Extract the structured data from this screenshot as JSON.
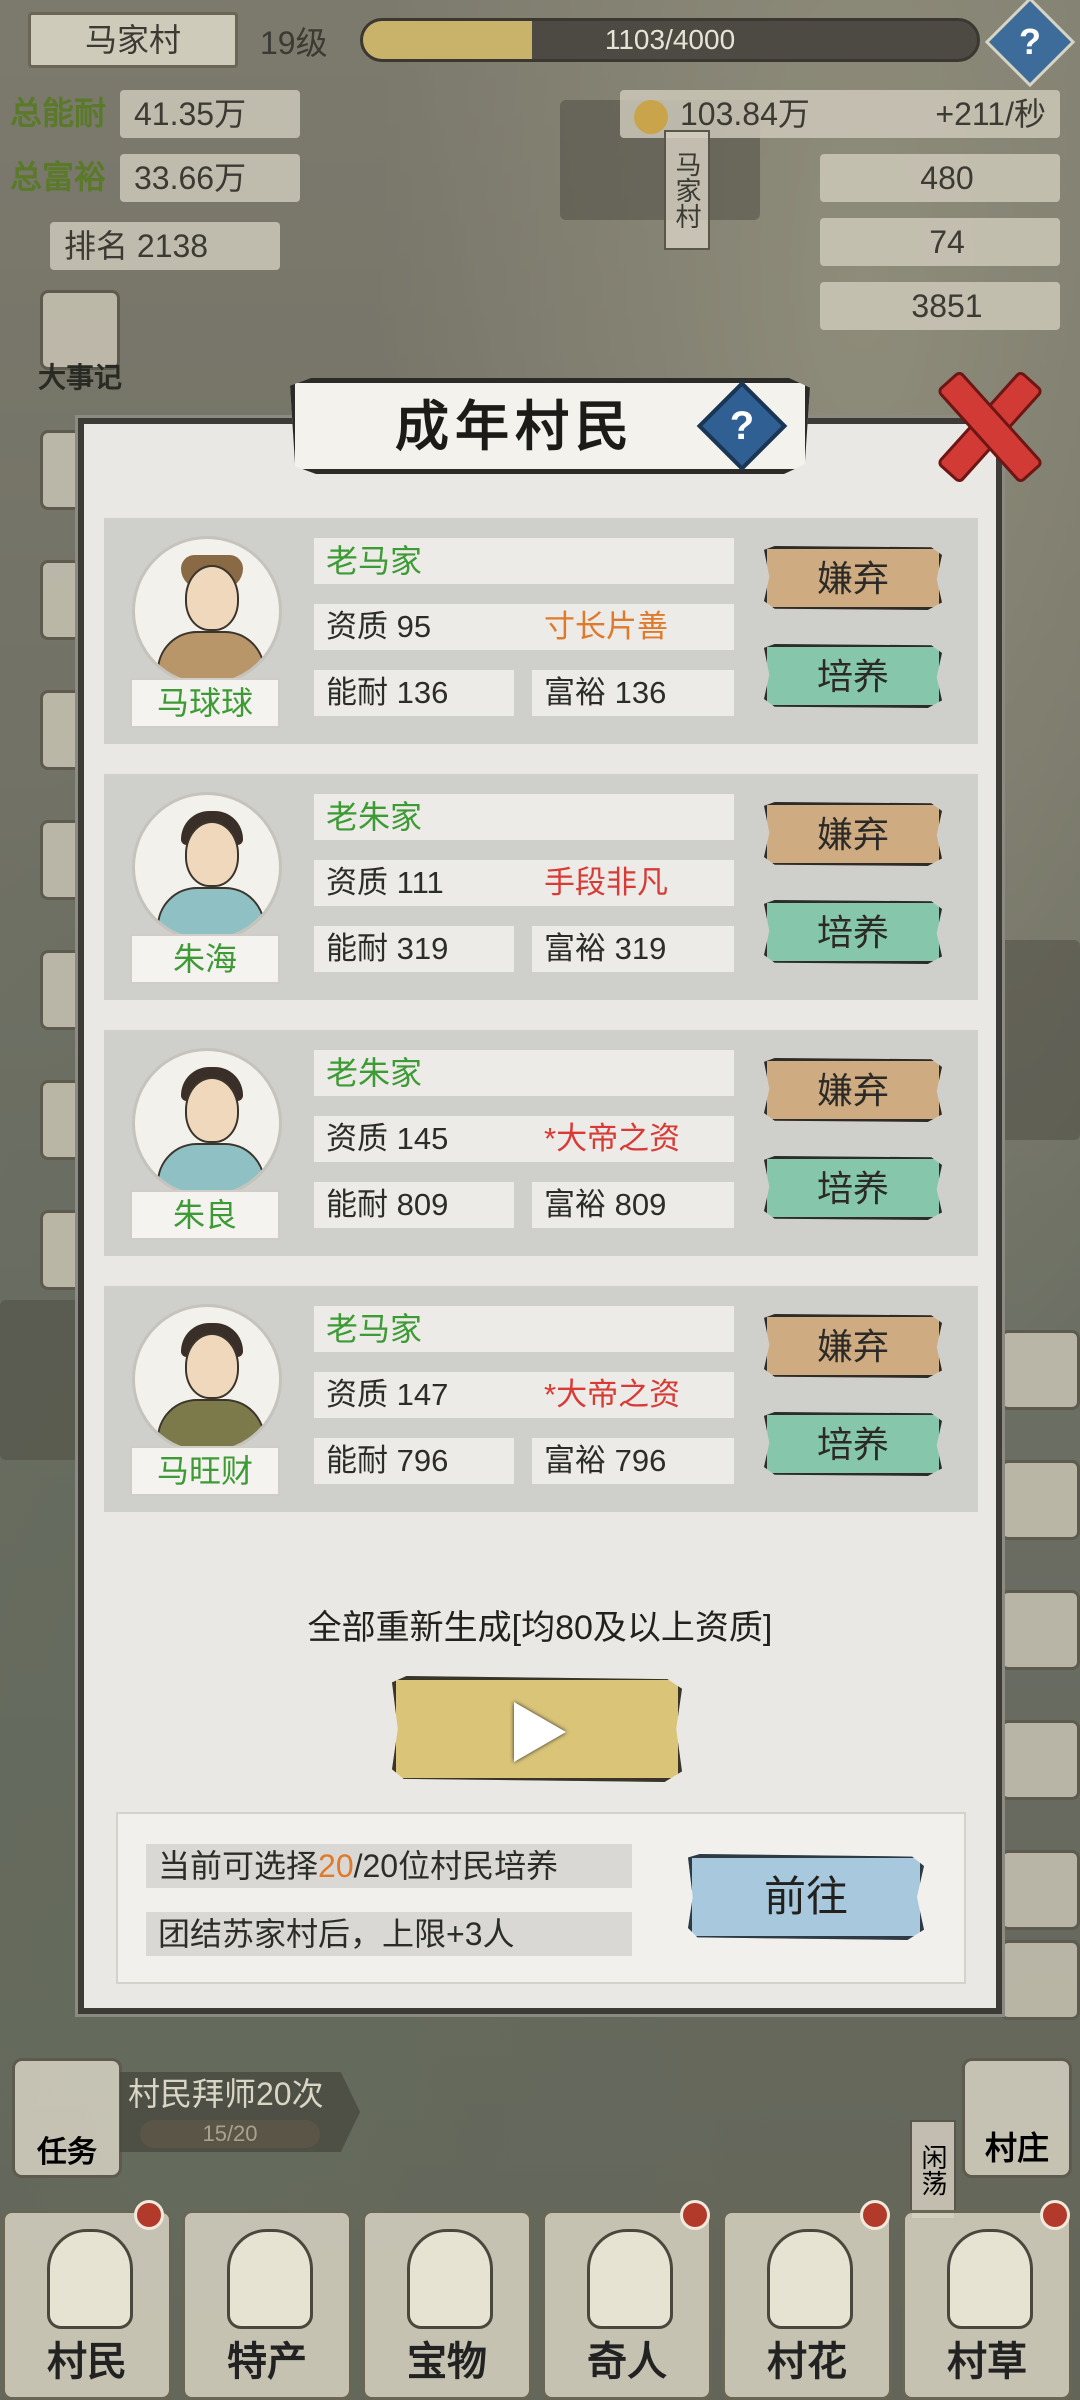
{
  "top": {
    "village_name": "马家村",
    "level": "19级",
    "exp_text": "1103/4000",
    "exp_fraction": 0.2758,
    "help": "?"
  },
  "stats": {
    "total_ability_label": "总能耐",
    "total_ability": "41.35万",
    "total_wealth_label": "总富裕",
    "total_wealth": "33.66万",
    "rank": "排名 2138",
    "coins": "103.84万",
    "coins_rate": "+211/秒",
    "gold": "480",
    "tickets": "74",
    "silver": "3851",
    "village_sign": "马家村"
  },
  "side": {
    "chronicle": "大事记"
  },
  "modal": {
    "title": "成年村民",
    "help": "?",
    "discard_label": "嫌弃",
    "train_label": "培养",
    "aptitude_prefix": "资质",
    "ability_prefix": "能耐",
    "wealth_prefix": "富裕",
    "villagers": [
      {
        "name": "马球球",
        "family": "老马家",
        "aptitude": "95",
        "trait": "寸长片善",
        "trait_color": "#e0792a",
        "ability": "136",
        "wealth": "136"
      },
      {
        "name": "朱海",
        "family": "老朱家",
        "aptitude": "111",
        "trait": "手段非凡",
        "trait_color": "#d93a36",
        "ability": "319",
        "wealth": "319"
      },
      {
        "name": "朱良",
        "family": "老朱家",
        "aptitude": "145",
        "trait": "*大帝之资",
        "trait_color": "#d93a36",
        "ability": "809",
        "wealth": "809"
      },
      {
        "name": "马旺财",
        "family": "老马家",
        "aptitude": "147",
        "trait": "*大帝之资",
        "trait_color": "#d93a36",
        "ability": "796",
        "wealth": "796"
      }
    ],
    "regenerate_text": "全部重新生成[均80及以上资质]",
    "info_selectable_prefix": "当前可选择",
    "info_selectable_count": "20",
    "info_selectable_suffix": "/20位村民培养",
    "info_unite": "团结苏家村后，上限+3人",
    "goto_label": "前往"
  },
  "bottom": {
    "task_label": "任务",
    "quest_text": "村民拜师20次",
    "quest_progress": "15/20",
    "wander": "闲荡",
    "village_label": "村庄",
    "tabs": [
      {
        "label": "村民",
        "icon": "villager-icon"
      },
      {
        "label": "特产",
        "icon": "specialty-icon"
      },
      {
        "label": "宝物",
        "icon": "treasure-icon"
      },
      {
        "label": "奇人",
        "icon": "stranger-icon"
      },
      {
        "label": "村花",
        "icon": "village-belle-icon"
      },
      {
        "label": "村草",
        "icon": "village-hunk-icon"
      }
    ]
  },
  "colors": {
    "green_text": "#3d9a34",
    "orange_trait": "#e0792a",
    "red_trait": "#d93a36",
    "discard_button": "#cfab82",
    "train_button": "#86c6ab",
    "goto_button": "#a8c8dd"
  }
}
